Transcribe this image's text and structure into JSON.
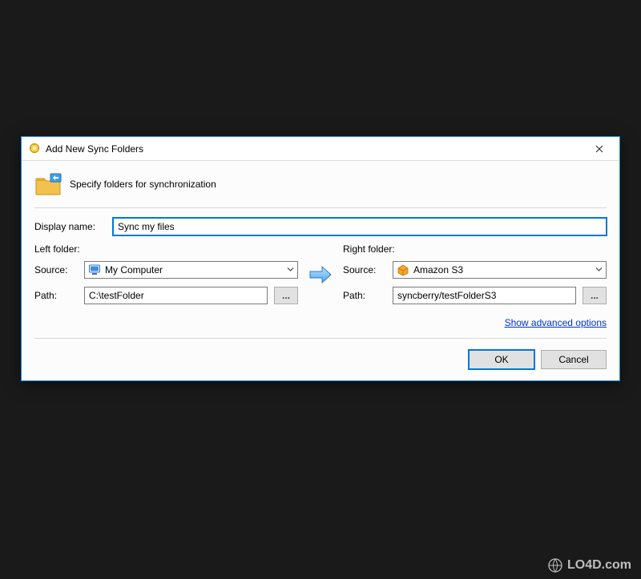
{
  "dialog": {
    "title": "Add New Sync Folders",
    "subtitle": "Specify folders for synchronization",
    "display_name_label": "Display name:",
    "display_name_value": "Sync my files",
    "left": {
      "heading": "Left folder:",
      "source_label": "Source:",
      "source_value": "My Computer",
      "path_label": "Path:",
      "path_value": "C:\\testFolder",
      "browse_label": "..."
    },
    "right": {
      "heading": "Right folder:",
      "source_label": "Source:",
      "source_value": "Amazon S3",
      "path_label": "Path:",
      "path_value": "syncberry/testFolderS3",
      "browse_label": "..."
    },
    "advanced_link": "Show advanced options",
    "ok_label": "OK",
    "cancel_label": "Cancel"
  },
  "watermark": "LO4D.com"
}
